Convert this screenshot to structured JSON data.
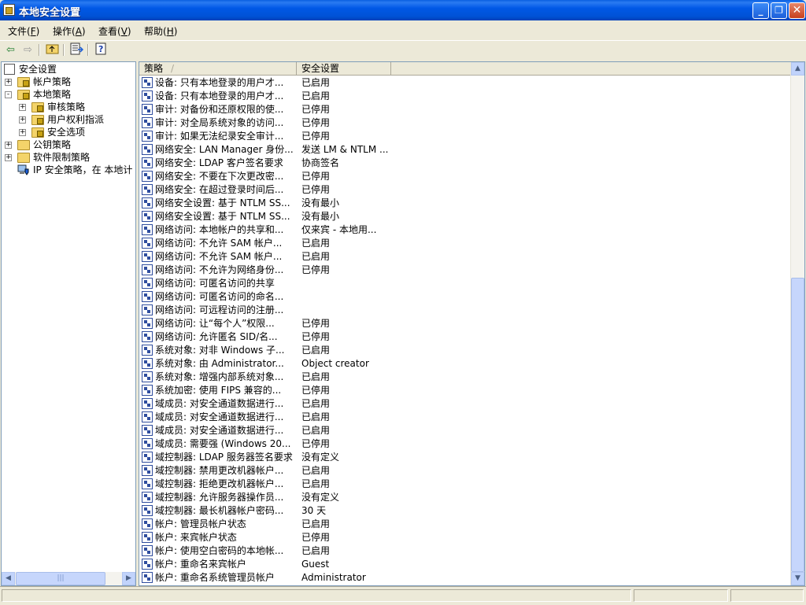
{
  "window": {
    "title": "本地安全设置",
    "title_icon": "security-policy-icon",
    "controls": [
      "minimize",
      "restore",
      "close"
    ]
  },
  "menu": [
    {
      "label": "文件(",
      "key": "F",
      "tail": ")"
    },
    {
      "label": "操作(",
      "key": "A",
      "tail": ")"
    },
    {
      "label": "查看(",
      "key": "V",
      "tail": ")"
    },
    {
      "label": "帮助(",
      "key": "H",
      "tail": ")"
    }
  ],
  "toolbar": {
    "icons": [
      "back-arrow-icon",
      "forward-arrow-icon",
      "up-folder-icon",
      "export-list-icon",
      "help-icon"
    ]
  },
  "tree": {
    "root": "安全设置",
    "items": [
      {
        "label": "帐户策略",
        "expand": "+"
      },
      {
        "label": "本地策略",
        "expand": "-"
      },
      {
        "label": "审核策略",
        "expand": "+"
      },
      {
        "label": "用户权利指派",
        "expand": "+"
      },
      {
        "label": "安全选项",
        "expand": "",
        "selected": true
      },
      {
        "label": "公钥策略",
        "expand": "+"
      },
      {
        "label": "软件限制策略",
        "expand": "+"
      },
      {
        "label": "IP 安全策略，在 本地计",
        "expand": ""
      }
    ]
  },
  "list": {
    "columns": [
      "策略",
      "安全设置"
    ],
    "sort_indicator": "/",
    "rows": [
      {
        "policy": "设备: 只有本地登录的用户才...",
        "setting": "已启用"
      },
      {
        "policy": "设备: 只有本地登录的用户才...",
        "setting": "已启用"
      },
      {
        "policy": "审计: 对备份和还原权限的使...",
        "setting": "已停用"
      },
      {
        "policy": "审计: 对全局系统对象的访问...",
        "setting": "已停用"
      },
      {
        "policy": "审计: 如果无法纪录安全审计...",
        "setting": "已停用"
      },
      {
        "policy": "网络安全: LAN Manager 身份...",
        "setting": "发送 LM & NTLM ..."
      },
      {
        "policy": "网络安全: LDAP 客户签名要求",
        "setting": "协商签名"
      },
      {
        "policy": "网络安全: 不要在下次更改密...",
        "setting": "已停用"
      },
      {
        "policy": "网络安全: 在超过登录时间后...",
        "setting": "已停用"
      },
      {
        "policy": "网络安全设置: 基于 NTLM SS...",
        "setting": "没有最小"
      },
      {
        "policy": "网络安全设置: 基于 NTLM SS...",
        "setting": "没有最小"
      },
      {
        "policy": "网络访问: 本地帐户的共享和...",
        "setting": "仅来宾 - 本地用..."
      },
      {
        "policy": "网络访问: 不允许 SAM 帐户...",
        "setting": "已启用"
      },
      {
        "policy": "网络访问: 不允许 SAM 帐户...",
        "setting": "已启用"
      },
      {
        "policy": "网络访问: 不允许为网络身份...",
        "setting": "已停用"
      },
      {
        "policy": "网络访问: 可匿名访问的共享",
        "setting": ""
      },
      {
        "policy": "网络访问: 可匿名访问的命名...",
        "setting": ""
      },
      {
        "policy": "网络访问: 可远程访问的注册...",
        "setting": ""
      },
      {
        "policy": "网络访问: 让“每个人”权限...",
        "setting": "已停用"
      },
      {
        "policy": "网络访问: 允许匿名 SID/名...",
        "setting": "已停用"
      },
      {
        "policy": "系统对象: 对非 Windows 子...",
        "setting": "已启用"
      },
      {
        "policy": "系统对象: 由 Administrator...",
        "setting": "Object creator"
      },
      {
        "policy": "系统对象: 增强内部系统对象...",
        "setting": "已启用"
      },
      {
        "policy": "系统加密: 使用 FIPS 兼容的...",
        "setting": "已停用"
      },
      {
        "policy": "域成员: 对安全通道数据进行...",
        "setting": "已启用"
      },
      {
        "policy": "域成员: 对安全通道数据进行...",
        "setting": "已启用"
      },
      {
        "policy": "域成员: 对安全通道数据进行...",
        "setting": "已启用"
      },
      {
        "policy": "域成员: 需要强 (Windows 20...",
        "setting": "已停用"
      },
      {
        "policy": "域控制器: LDAP 服务器签名要求",
        "setting": "没有定义"
      },
      {
        "policy": "域控制器: 禁用更改机器帐户...",
        "setting": "已启用"
      },
      {
        "policy": "域控制器: 拒绝更改机器帐户...",
        "setting": "已启用"
      },
      {
        "policy": "域控制器: 允许服务器操作员...",
        "setting": "没有定义"
      },
      {
        "policy": "域控制器: 最长机器帐户密码...",
        "setting": "30 天"
      },
      {
        "policy": "帐户: 管理员帐户状态",
        "setting": "已启用"
      },
      {
        "policy": "帐户: 来宾帐户状态",
        "setting": "已停用"
      },
      {
        "policy": "帐户: 使用空白密码的本地帐...",
        "setting": "已启用"
      },
      {
        "policy": "帐户: 重命名来宾帐户",
        "setting": "Guest"
      },
      {
        "policy": "帐户: 重命名系统管理员帐户",
        "setting": "Administrator"
      }
    ]
  },
  "scroll": {
    "vertical_position": 0.45,
    "horizontal_position": 0.3
  }
}
